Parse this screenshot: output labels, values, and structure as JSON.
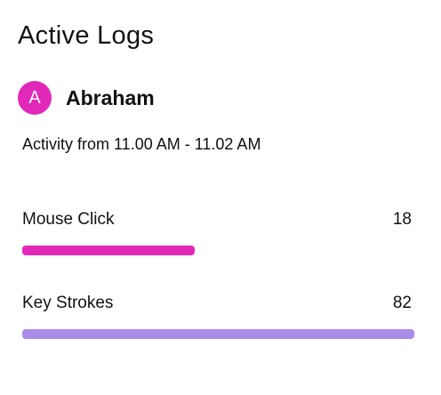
{
  "title": "Active Logs",
  "user": {
    "avatar_initial": "A",
    "name": "Abraham"
  },
  "activity_text": "Activity from 11.00 AM - 11.02 AM",
  "metrics": [
    {
      "label": "Mouse Click",
      "value": "18",
      "bar_fraction": 0.44,
      "color": "#e128b8"
    },
    {
      "label": "Key Strokes",
      "value": "82",
      "bar_fraction": 1.0,
      "color": "#a98be8"
    }
  ],
  "colors": {
    "avatar_bg": "#e128b8",
    "text": "#111111",
    "background": "#ffffff"
  }
}
